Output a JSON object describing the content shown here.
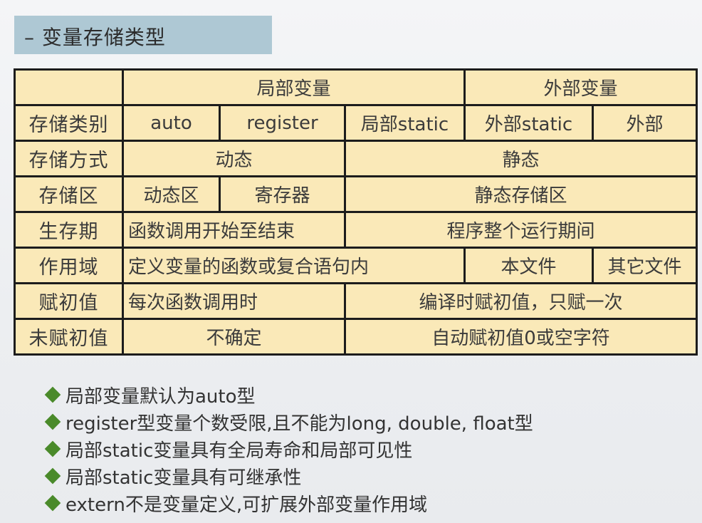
{
  "title": "– 变量存储类型",
  "table": {
    "header": {
      "local": "局部变量",
      "external": "外部变量"
    },
    "rows": {
      "class": {
        "label": "存储类别",
        "auto": "auto",
        "register": "register",
        "local_static": "局部static",
        "ext_static": "外部static",
        "ext": "外部"
      },
      "mode": {
        "label": "存储方式",
        "dynamic": "动态",
        "static": "静态"
      },
      "area": {
        "label": "存储区",
        "dyn_area": "动态区",
        "register": "寄存器",
        "static_area": "静态存储区"
      },
      "lifetime": {
        "label": "生存期",
        "local": "函数调用开始至结束",
        "global": "程序整个运行期间"
      },
      "scope": {
        "label": "作用域",
        "local": "定义变量的函数或复合语句内",
        "file": "本文件",
        "other": "其它文件"
      },
      "init": {
        "label": "赋初值",
        "local": "每次函数调用时",
        "static": "编译时赋初值，只赋一次"
      },
      "uninit": {
        "label": "未赋初值",
        "local": "不确定",
        "static": "自动赋初值0或空字符"
      }
    }
  },
  "bullets": [
    "局部变量默认为auto型",
    "register型变量个数受限,且不能为long, double, float型",
    "局部static变量具有全局寿命和局部可见性",
    "局部static变量具有可继承性",
    "extern不是变量定义,可扩展外部变量作用域"
  ]
}
